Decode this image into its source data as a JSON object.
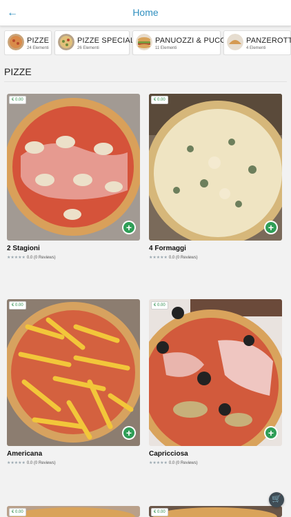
{
  "header": {
    "title": "Home",
    "back_icon": "arrow-left-icon"
  },
  "categories": [
    {
      "title": "PIZZE",
      "count": "24 Elementi"
    },
    {
      "title": "PIZZE SPECIALI",
      "count": "26 Elementi"
    },
    {
      "title": "PANUOZZI & PUCCE",
      "count": "11 Elementi"
    },
    {
      "title": "PANZEROTTI",
      "count": "4 Elementi"
    }
  ],
  "section": {
    "title": "PIZZE"
  },
  "products": [
    {
      "name": "2 Stagioni",
      "price": "€ 0.00",
      "rating": "0.0 (0 Reviews)"
    },
    {
      "name": "4 Formaggi",
      "price": "€ 0.00",
      "rating": "0.0 (0 Reviews)"
    },
    {
      "name": "Americana",
      "price": "€ 0.00",
      "rating": "0.0 (0 Reviews)"
    },
    {
      "name": "Capricciosa",
      "price": "€ 0.00",
      "rating": "0.0 (0 Reviews)"
    },
    {
      "price": "€ 0.00"
    },
    {
      "price": "€ 0.00"
    }
  ],
  "colors": {
    "accent": "#2f8fbf",
    "add_button": "#2f9e57",
    "cart_button": "#3f4c55"
  },
  "cart": {
    "icon": "shopping-cart-icon"
  }
}
